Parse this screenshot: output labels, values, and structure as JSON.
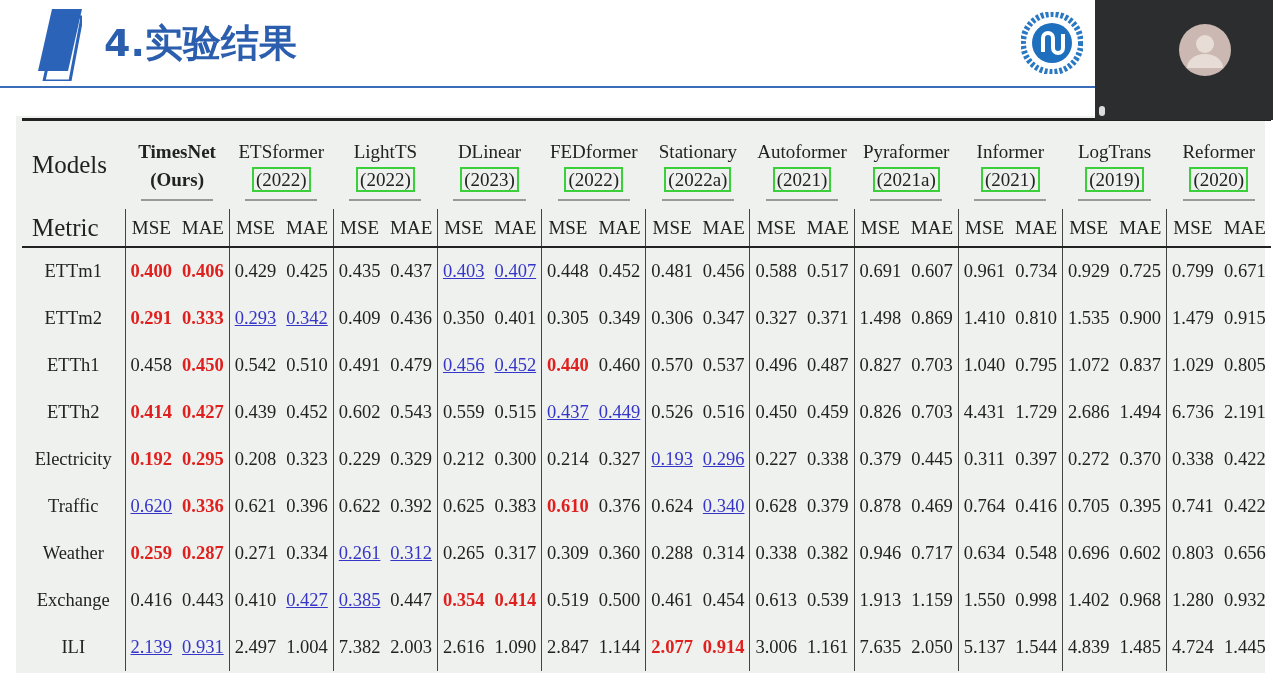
{
  "slide": {
    "title": "4.实验结果"
  },
  "table": {
    "models_label": "Models",
    "metric_label": "Metric",
    "models": [
      {
        "name": "TimesNet",
        "note": "(Ours)",
        "kind": "ours",
        "metrics": [
          "MSE",
          "MAE"
        ]
      },
      {
        "name": "ETSformer",
        "note": "(2022)",
        "kind": "cited",
        "metrics": [
          "MSE",
          "MAE"
        ]
      },
      {
        "name": "LightTS",
        "note": "(2022)",
        "kind": "cited",
        "metrics": [
          "MSE",
          "MAE"
        ]
      },
      {
        "name": "DLinear",
        "note": "(2023)",
        "kind": "cited",
        "metrics": [
          "MSE",
          "MAE"
        ]
      },
      {
        "name": "FEDformer",
        "note": "(2022)",
        "kind": "cited",
        "metrics": [
          "MSE",
          "MAE"
        ]
      },
      {
        "name": "Stationary",
        "note": "(2022a)",
        "kind": "cited",
        "metrics": [
          "MSE",
          "MAE"
        ]
      },
      {
        "name": "Autoformer",
        "note": "(2021)",
        "kind": "cited",
        "metrics": [
          "MSE",
          "MAE"
        ]
      },
      {
        "name": "Pyraformer",
        "note": "(2021a)",
        "kind": "cited",
        "metrics": [
          "MSE",
          "MAE"
        ]
      },
      {
        "name": "Informer",
        "note": "(2021)",
        "kind": "cited",
        "metrics": [
          "MSE",
          "MAE"
        ]
      },
      {
        "name": "LogTrans",
        "note": "(2019)",
        "kind": "cited",
        "metrics": [
          "MSE",
          "MAE"
        ]
      },
      {
        "name": "Reformer",
        "note": "(2020)",
        "kind": "cited",
        "metrics": [
          "MSE",
          "MAE"
        ]
      }
    ],
    "rows": [
      {
        "dataset": "ETTm1",
        "cells": [
          {
            "value": "0.400",
            "best": true,
            "second": false
          },
          {
            "value": "0.406",
            "best": true,
            "second": false
          },
          {
            "value": "0.429",
            "best": false,
            "second": false
          },
          {
            "value": "0.425",
            "best": false,
            "second": false
          },
          {
            "value": "0.435",
            "best": false,
            "second": false
          },
          {
            "value": "0.437",
            "best": false,
            "second": false
          },
          {
            "value": "0.403",
            "best": false,
            "second": true
          },
          {
            "value": "0.407",
            "best": false,
            "second": true
          },
          {
            "value": "0.448",
            "best": false,
            "second": false
          },
          {
            "value": "0.452",
            "best": false,
            "second": false
          },
          {
            "value": "0.481",
            "best": false,
            "second": false
          },
          {
            "value": "0.456",
            "best": false,
            "second": false
          },
          {
            "value": "0.588",
            "best": false,
            "second": false
          },
          {
            "value": "0.517",
            "best": false,
            "second": false
          },
          {
            "value": "0.691",
            "best": false,
            "second": false
          },
          {
            "value": "0.607",
            "best": false,
            "second": false
          },
          {
            "value": "0.961",
            "best": false,
            "second": false
          },
          {
            "value": "0.734",
            "best": false,
            "second": false
          },
          {
            "value": "0.929",
            "best": false,
            "second": false
          },
          {
            "value": "0.725",
            "best": false,
            "second": false
          },
          {
            "value": "0.799",
            "best": false,
            "second": false
          },
          {
            "value": "0.671",
            "best": false,
            "second": false
          }
        ]
      },
      {
        "dataset": "ETTm2",
        "cells": [
          {
            "value": "0.291",
            "best": true,
            "second": false
          },
          {
            "value": "0.333",
            "best": true,
            "second": false
          },
          {
            "value": "0.293",
            "best": false,
            "second": true
          },
          {
            "value": "0.342",
            "best": false,
            "second": true
          },
          {
            "value": "0.409",
            "best": false,
            "second": false
          },
          {
            "value": "0.436",
            "best": false,
            "second": false
          },
          {
            "value": "0.350",
            "best": false,
            "second": false
          },
          {
            "value": "0.401",
            "best": false,
            "second": false
          },
          {
            "value": "0.305",
            "best": false,
            "second": false
          },
          {
            "value": "0.349",
            "best": false,
            "second": false
          },
          {
            "value": "0.306",
            "best": false,
            "second": false
          },
          {
            "value": "0.347",
            "best": false,
            "second": false
          },
          {
            "value": "0.327",
            "best": false,
            "second": false
          },
          {
            "value": "0.371",
            "best": false,
            "second": false
          },
          {
            "value": "1.498",
            "best": false,
            "second": false
          },
          {
            "value": "0.869",
            "best": false,
            "second": false
          },
          {
            "value": "1.410",
            "best": false,
            "second": false
          },
          {
            "value": "0.810",
            "best": false,
            "second": false
          },
          {
            "value": "1.535",
            "best": false,
            "second": false
          },
          {
            "value": "0.900",
            "best": false,
            "second": false
          },
          {
            "value": "1.479",
            "best": false,
            "second": false
          },
          {
            "value": "0.915",
            "best": false,
            "second": false
          }
        ]
      },
      {
        "dataset": "ETTh1",
        "cells": [
          {
            "value": "0.458",
            "best": false,
            "second": false
          },
          {
            "value": "0.450",
            "best": true,
            "second": false
          },
          {
            "value": "0.542",
            "best": false,
            "second": false
          },
          {
            "value": "0.510",
            "best": false,
            "second": false
          },
          {
            "value": "0.491",
            "best": false,
            "second": false
          },
          {
            "value": "0.479",
            "best": false,
            "second": false
          },
          {
            "value": "0.456",
            "best": false,
            "second": true
          },
          {
            "value": "0.452",
            "best": false,
            "second": true
          },
          {
            "value": "0.440",
            "best": true,
            "second": false
          },
          {
            "value": "0.460",
            "best": false,
            "second": false
          },
          {
            "value": "0.570",
            "best": false,
            "second": false
          },
          {
            "value": "0.537",
            "best": false,
            "second": false
          },
          {
            "value": "0.496",
            "best": false,
            "second": false
          },
          {
            "value": "0.487",
            "best": false,
            "second": false
          },
          {
            "value": "0.827",
            "best": false,
            "second": false
          },
          {
            "value": "0.703",
            "best": false,
            "second": false
          },
          {
            "value": "1.040",
            "best": false,
            "second": false
          },
          {
            "value": "0.795",
            "best": false,
            "second": false
          },
          {
            "value": "1.072",
            "best": false,
            "second": false
          },
          {
            "value": "0.837",
            "best": false,
            "second": false
          },
          {
            "value": "1.029",
            "best": false,
            "second": false
          },
          {
            "value": "0.805",
            "best": false,
            "second": false
          }
        ]
      },
      {
        "dataset": "ETTh2",
        "cells": [
          {
            "value": "0.414",
            "best": true,
            "second": false
          },
          {
            "value": "0.427",
            "best": true,
            "second": false
          },
          {
            "value": "0.439",
            "best": false,
            "second": false
          },
          {
            "value": "0.452",
            "best": false,
            "second": false
          },
          {
            "value": "0.602",
            "best": false,
            "second": false
          },
          {
            "value": "0.543",
            "best": false,
            "second": false
          },
          {
            "value": "0.559",
            "best": false,
            "second": false
          },
          {
            "value": "0.515",
            "best": false,
            "second": false
          },
          {
            "value": "0.437",
            "best": false,
            "second": true
          },
          {
            "value": "0.449",
            "best": false,
            "second": true
          },
          {
            "value": "0.526",
            "best": false,
            "second": false
          },
          {
            "value": "0.516",
            "best": false,
            "second": false
          },
          {
            "value": "0.450",
            "best": false,
            "second": false
          },
          {
            "value": "0.459",
            "best": false,
            "second": false
          },
          {
            "value": "0.826",
            "best": false,
            "second": false
          },
          {
            "value": "0.703",
            "best": false,
            "second": false
          },
          {
            "value": "4.431",
            "best": false,
            "second": false
          },
          {
            "value": "1.729",
            "best": false,
            "second": false
          },
          {
            "value": "2.686",
            "best": false,
            "second": false
          },
          {
            "value": "1.494",
            "best": false,
            "second": false
          },
          {
            "value": "6.736",
            "best": false,
            "second": false
          },
          {
            "value": "2.191",
            "best": false,
            "second": false
          }
        ]
      },
      {
        "dataset": "Electricity",
        "cells": [
          {
            "value": "0.192",
            "best": true,
            "second": false
          },
          {
            "value": "0.295",
            "best": true,
            "second": false
          },
          {
            "value": "0.208",
            "best": false,
            "second": false
          },
          {
            "value": "0.323",
            "best": false,
            "second": false
          },
          {
            "value": "0.229",
            "best": false,
            "second": false
          },
          {
            "value": "0.329",
            "best": false,
            "second": false
          },
          {
            "value": "0.212",
            "best": false,
            "second": false
          },
          {
            "value": "0.300",
            "best": false,
            "second": false
          },
          {
            "value": "0.214",
            "best": false,
            "second": false
          },
          {
            "value": "0.327",
            "best": false,
            "second": false
          },
          {
            "value": "0.193",
            "best": false,
            "second": true
          },
          {
            "value": "0.296",
            "best": false,
            "second": true
          },
          {
            "value": "0.227",
            "best": false,
            "second": false
          },
          {
            "value": "0.338",
            "best": false,
            "second": false
          },
          {
            "value": "0.379",
            "best": false,
            "second": false
          },
          {
            "value": "0.445",
            "best": false,
            "second": false
          },
          {
            "value": "0.311",
            "best": false,
            "second": false
          },
          {
            "value": "0.397",
            "best": false,
            "second": false
          },
          {
            "value": "0.272",
            "best": false,
            "second": false
          },
          {
            "value": "0.370",
            "best": false,
            "second": false
          },
          {
            "value": "0.338",
            "best": false,
            "second": false
          },
          {
            "value": "0.422",
            "best": false,
            "second": false
          }
        ]
      },
      {
        "dataset": "Traffic",
        "cells": [
          {
            "value": "0.620",
            "best": false,
            "second": true
          },
          {
            "value": "0.336",
            "best": true,
            "second": false
          },
          {
            "value": "0.621",
            "best": false,
            "second": false
          },
          {
            "value": "0.396",
            "best": false,
            "second": false
          },
          {
            "value": "0.622",
            "best": false,
            "second": false
          },
          {
            "value": "0.392",
            "best": false,
            "second": false
          },
          {
            "value": "0.625",
            "best": false,
            "second": false
          },
          {
            "value": "0.383",
            "best": false,
            "second": false
          },
          {
            "value": "0.610",
            "best": true,
            "second": false
          },
          {
            "value": "0.376",
            "best": false,
            "second": false
          },
          {
            "value": "0.624",
            "best": false,
            "second": false
          },
          {
            "value": "0.340",
            "best": false,
            "second": true
          },
          {
            "value": "0.628",
            "best": false,
            "second": false
          },
          {
            "value": "0.379",
            "best": false,
            "second": false
          },
          {
            "value": "0.878",
            "best": false,
            "second": false
          },
          {
            "value": "0.469",
            "best": false,
            "second": false
          },
          {
            "value": "0.764",
            "best": false,
            "second": false
          },
          {
            "value": "0.416",
            "best": false,
            "second": false
          },
          {
            "value": "0.705",
            "best": false,
            "second": false
          },
          {
            "value": "0.395",
            "best": false,
            "second": false
          },
          {
            "value": "0.741",
            "best": false,
            "second": false
          },
          {
            "value": "0.422",
            "best": false,
            "second": false
          }
        ]
      },
      {
        "dataset": "Weather",
        "cells": [
          {
            "value": "0.259",
            "best": true,
            "second": false
          },
          {
            "value": "0.287",
            "best": true,
            "second": false
          },
          {
            "value": "0.271",
            "best": false,
            "second": false
          },
          {
            "value": "0.334",
            "best": false,
            "second": false
          },
          {
            "value": "0.261",
            "best": false,
            "second": true
          },
          {
            "value": "0.312",
            "best": false,
            "second": true
          },
          {
            "value": "0.265",
            "best": false,
            "second": false
          },
          {
            "value": "0.317",
            "best": false,
            "second": false
          },
          {
            "value": "0.309",
            "best": false,
            "second": false
          },
          {
            "value": "0.360",
            "best": false,
            "second": false
          },
          {
            "value": "0.288",
            "best": false,
            "second": false
          },
          {
            "value": "0.314",
            "best": false,
            "second": false
          },
          {
            "value": "0.338",
            "best": false,
            "second": false
          },
          {
            "value": "0.382",
            "best": false,
            "second": false
          },
          {
            "value": "0.946",
            "best": false,
            "second": false
          },
          {
            "value": "0.717",
            "best": false,
            "second": false
          },
          {
            "value": "0.634",
            "best": false,
            "second": false
          },
          {
            "value": "0.548",
            "best": false,
            "second": false
          },
          {
            "value": "0.696",
            "best": false,
            "second": false
          },
          {
            "value": "0.602",
            "best": false,
            "second": false
          },
          {
            "value": "0.803",
            "best": false,
            "second": false
          },
          {
            "value": "0.656",
            "best": false,
            "second": false
          }
        ]
      },
      {
        "dataset": "Exchange",
        "cells": [
          {
            "value": "0.416",
            "best": false,
            "second": false
          },
          {
            "value": "0.443",
            "best": false,
            "second": false
          },
          {
            "value": "0.410",
            "best": false,
            "second": false
          },
          {
            "value": "0.427",
            "best": false,
            "second": true
          },
          {
            "value": "0.385",
            "best": false,
            "second": true
          },
          {
            "value": "0.447",
            "best": false,
            "second": false
          },
          {
            "value": "0.354",
            "best": true,
            "second": false
          },
          {
            "value": "0.414",
            "best": true,
            "second": false
          },
          {
            "value": "0.519",
            "best": false,
            "second": false
          },
          {
            "value": "0.500",
            "best": false,
            "second": false
          },
          {
            "value": "0.461",
            "best": false,
            "second": false
          },
          {
            "value": "0.454",
            "best": false,
            "second": false
          },
          {
            "value": "0.613",
            "best": false,
            "second": false
          },
          {
            "value": "0.539",
            "best": false,
            "second": false
          },
          {
            "value": "1.913",
            "best": false,
            "second": false
          },
          {
            "value": "1.159",
            "best": false,
            "second": false
          },
          {
            "value": "1.550",
            "best": false,
            "second": false
          },
          {
            "value": "0.998",
            "best": false,
            "second": false
          },
          {
            "value": "1.402",
            "best": false,
            "second": false
          },
          {
            "value": "0.968",
            "best": false,
            "second": false
          },
          {
            "value": "1.280",
            "best": false,
            "second": false
          },
          {
            "value": "0.932",
            "best": false,
            "second": false
          }
        ]
      },
      {
        "dataset": "ILI",
        "cells": [
          {
            "value": "2.139",
            "best": false,
            "second": true
          },
          {
            "value": "0.931",
            "best": false,
            "second": true
          },
          {
            "value": "2.497",
            "best": false,
            "second": false
          },
          {
            "value": "1.004",
            "best": false,
            "second": false
          },
          {
            "value": "7.382",
            "best": false,
            "second": false
          },
          {
            "value": "2.003",
            "best": false,
            "second": false
          },
          {
            "value": "2.616",
            "best": false,
            "second": false
          },
          {
            "value": "1.090",
            "best": false,
            "second": false
          },
          {
            "value": "2.847",
            "best": false,
            "second": false
          },
          {
            "value": "1.144",
            "best": false,
            "second": false
          },
          {
            "value": "2.077",
            "best": true,
            "second": false
          },
          {
            "value": "0.914",
            "best": true,
            "second": false
          },
          {
            "value": "3.006",
            "best": false,
            "second": false
          },
          {
            "value": "1.161",
            "best": false,
            "second": false
          },
          {
            "value": "7.635",
            "best": false,
            "second": false
          },
          {
            "value": "2.050",
            "best": false,
            "second": false
          },
          {
            "value": "5.137",
            "best": false,
            "second": false
          },
          {
            "value": "1.544",
            "best": false,
            "second": false
          },
          {
            "value": "4.839",
            "best": false,
            "second": false
          },
          {
            "value": "1.485",
            "best": false,
            "second": false
          },
          {
            "value": "4.724",
            "best": false,
            "second": false
          },
          {
            "value": "1.445",
            "best": false,
            "second": false
          }
        ]
      }
    ]
  }
}
